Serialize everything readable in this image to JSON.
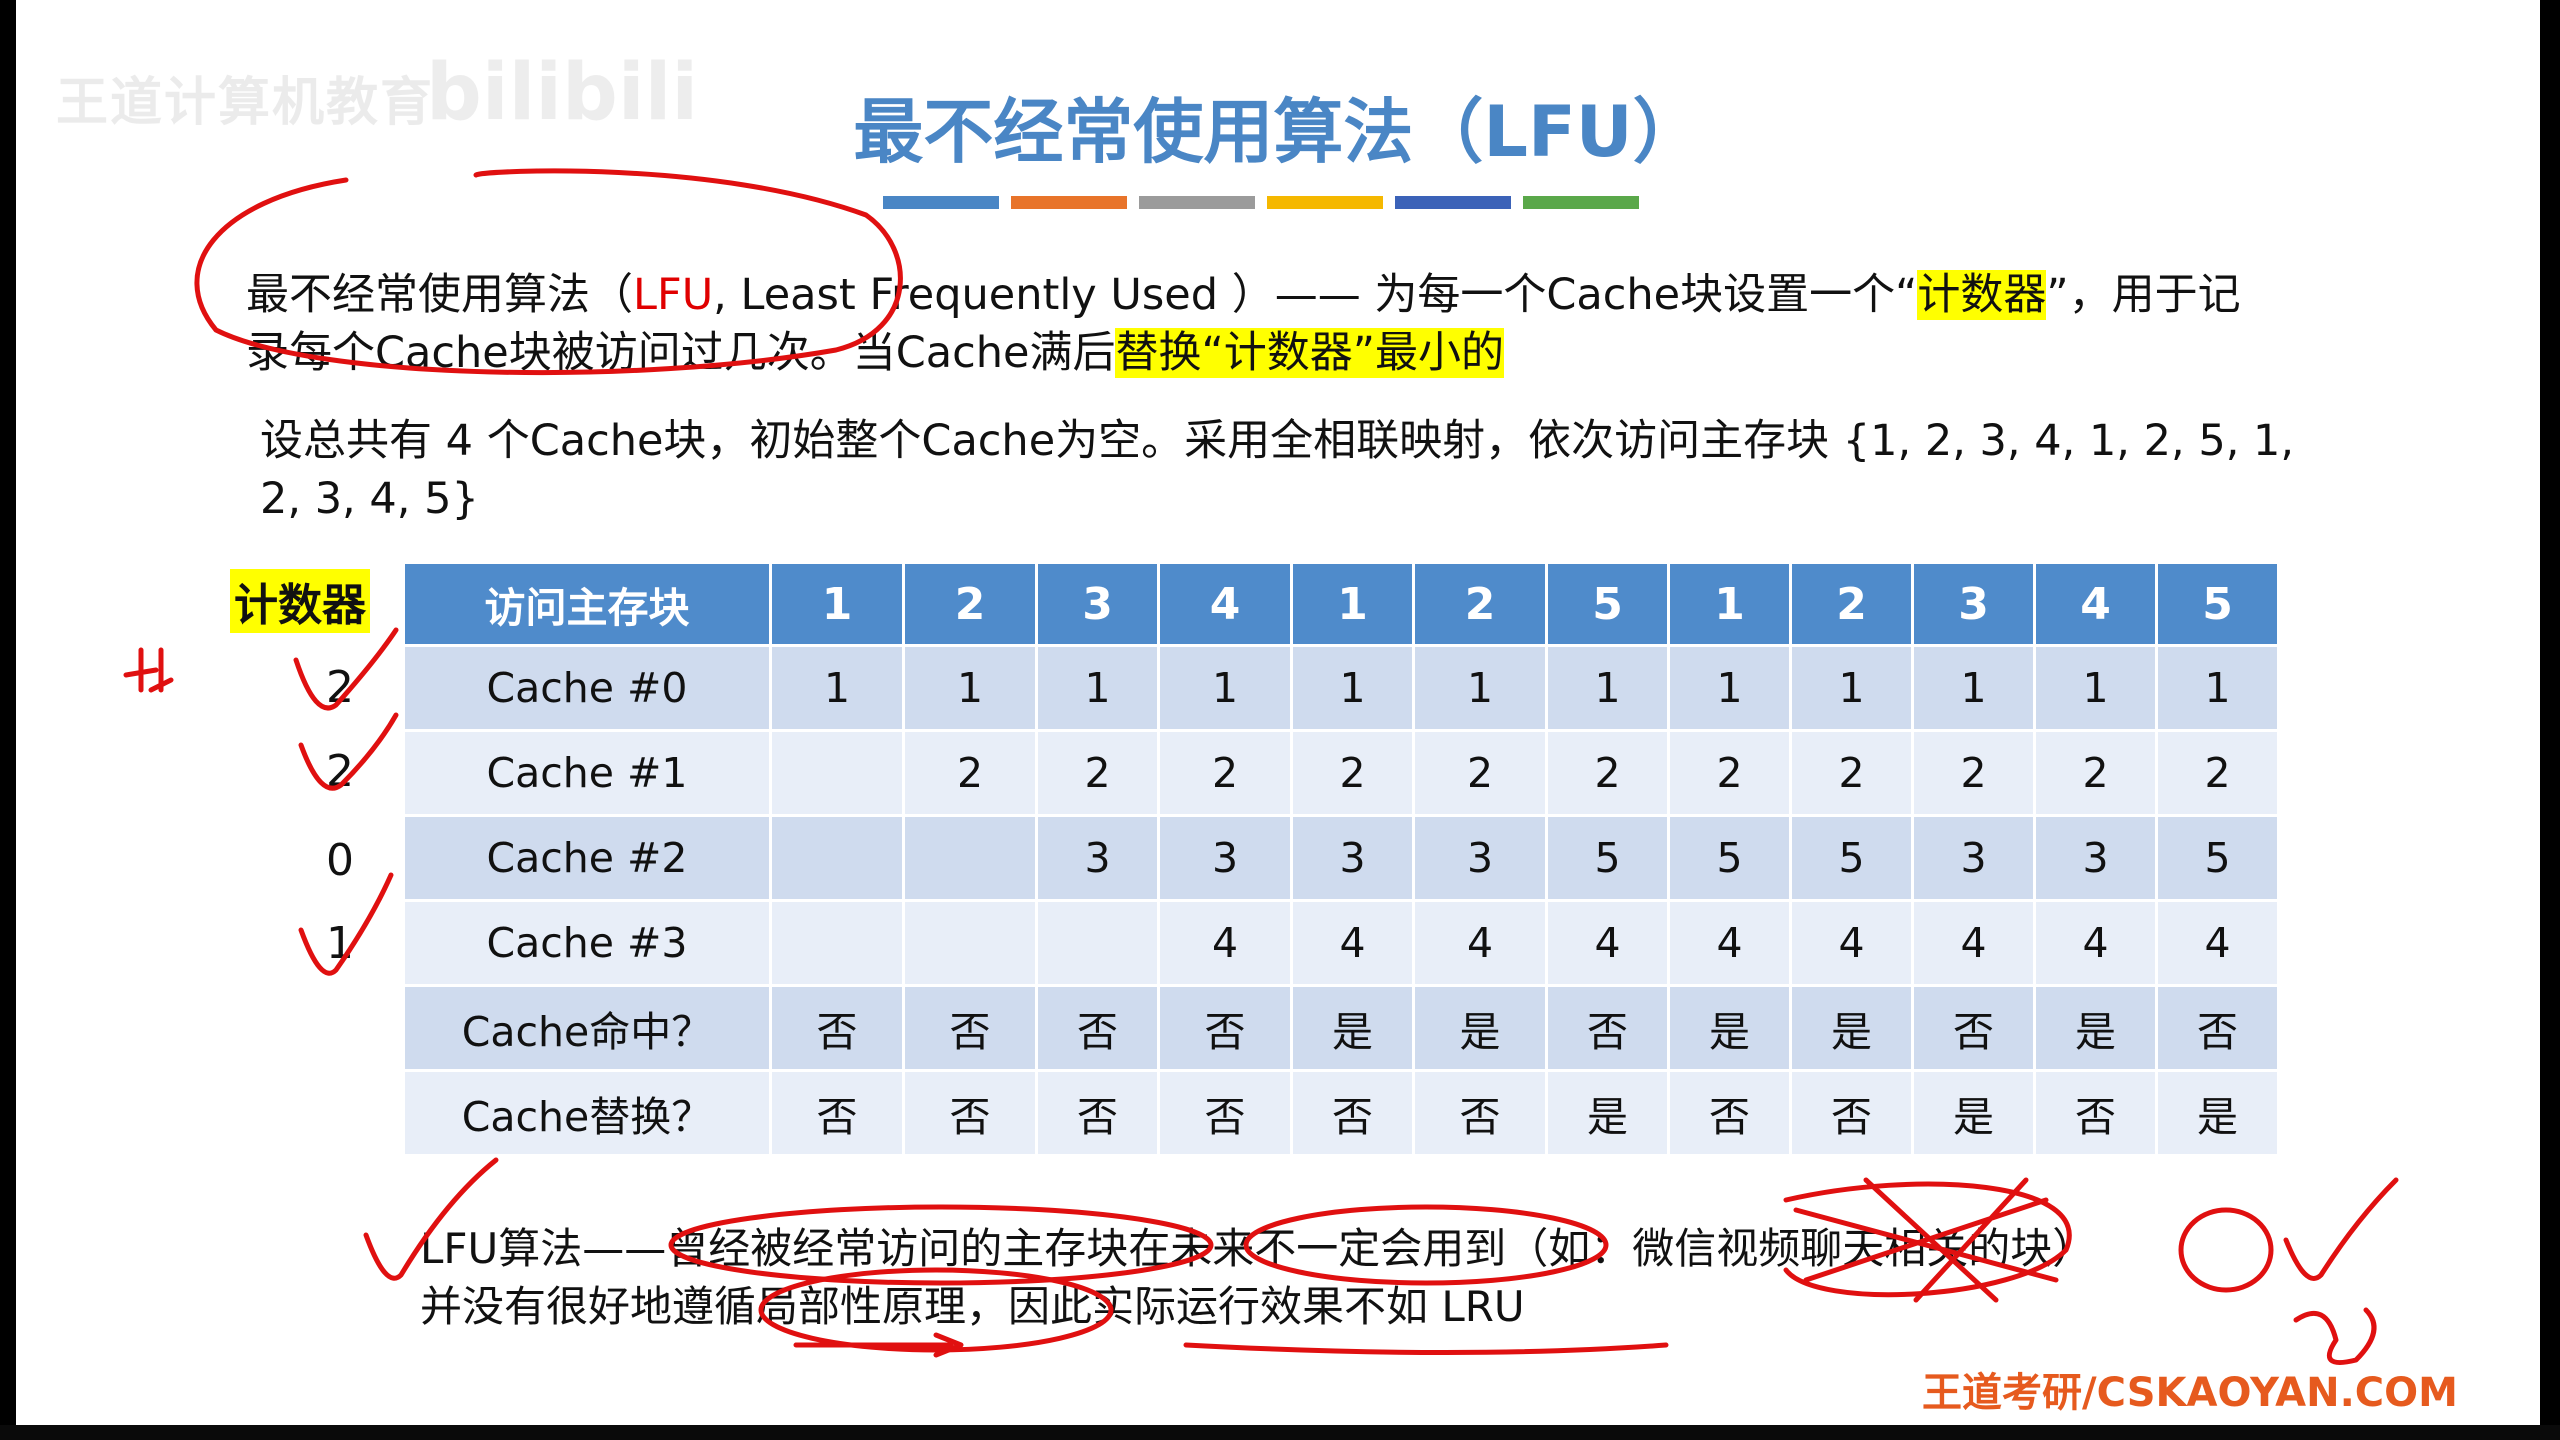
{
  "watermark": {
    "text": "王道计算机教育",
    "logo": "bilibili"
  },
  "title": "最不经常使用算法（LFU）",
  "title_bar_colors": [
    "#4a86c5",
    "#e8742a",
    "#9b9b9b",
    "#f5b800",
    "#3b62b8",
    "#5aa84a"
  ],
  "definition": {
    "part1": "最不经常使用算法（",
    "part2": "LFU",
    "part3": ", Least Frequently Used ）—— 为每一个Cache块设置一个“",
    "part4": "计数器",
    "part5": "”，用于记",
    "line2a": "录每个Cache块被访问过几次。当Cache满后",
    "line2b": "替换“计数器”最小的"
  },
  "setup": {
    "line1": "设总共有 4 个Cache块，初始整个Cache为空。采用全相联映射，依次访问主存块 {1, 2, 3, 4, 1, 2, 5, 1,",
    "line2": "2, 3, 4, 5}"
  },
  "counter": {
    "label": "计数器",
    "values": [
      "2",
      "2",
      "0",
      "1"
    ]
  },
  "table": {
    "header_label": "访问主存块",
    "accesses": [
      "1",
      "2",
      "3",
      "4",
      "1",
      "2",
      "5",
      "1",
      "2",
      "3",
      "4",
      "5"
    ],
    "rows": [
      {
        "label": "Cache #0",
        "cells": [
          [
            "1",
            "r"
          ],
          [
            "1",
            ""
          ],
          [
            "1",
            ""
          ],
          [
            "1",
            ""
          ],
          [
            "1",
            "g"
          ],
          [
            "1",
            ""
          ],
          [
            "1",
            ""
          ],
          [
            "1",
            "g"
          ],
          [
            "1",
            ""
          ],
          [
            "1",
            ""
          ],
          [
            "1",
            ""
          ],
          [
            "1",
            ""
          ]
        ]
      },
      {
        "label": "Cache #1",
        "cells": [
          [
            "",
            ""
          ],
          [
            "2",
            "r"
          ],
          [
            "2",
            ""
          ],
          [
            "2",
            ""
          ],
          [
            "2",
            ""
          ],
          [
            "2",
            "g"
          ],
          [
            "2",
            ""
          ],
          [
            "2",
            ""
          ],
          [
            "2",
            "g"
          ],
          [
            "2",
            ""
          ],
          [
            "2",
            ""
          ],
          [
            "2",
            ""
          ]
        ]
      },
      {
        "label": "Cache #2",
        "cells": [
          [
            "",
            ""
          ],
          [
            "",
            ""
          ],
          [
            "3",
            "r"
          ],
          [
            "3",
            ""
          ],
          [
            "3",
            ""
          ],
          [
            "3",
            ""
          ],
          [
            "5",
            "r"
          ],
          [
            "5",
            ""
          ],
          [
            "5",
            ""
          ],
          [
            "3",
            "r"
          ],
          [
            "3",
            ""
          ],
          [
            "5",
            "r"
          ]
        ]
      },
      {
        "label": "Cache #3",
        "cells": [
          [
            "",
            ""
          ],
          [
            "",
            ""
          ],
          [
            "",
            ""
          ],
          [
            "4",
            "r"
          ],
          [
            "4",
            ""
          ],
          [
            "4",
            ""
          ],
          [
            "4",
            ""
          ],
          [
            "4",
            ""
          ],
          [
            "4",
            ""
          ],
          [
            "4",
            ""
          ],
          [
            "4",
            "g"
          ],
          [
            "4",
            ""
          ]
        ]
      },
      {
        "label": "Cache命中？",
        "cells": [
          [
            "否",
            ""
          ],
          [
            "否",
            ""
          ],
          [
            "否",
            ""
          ],
          [
            "否",
            ""
          ],
          [
            "是",
            ""
          ],
          [
            "是",
            ""
          ],
          [
            "否",
            ""
          ],
          [
            "是",
            ""
          ],
          [
            "是",
            ""
          ],
          [
            "否",
            ""
          ],
          [
            "是",
            ""
          ],
          [
            "否",
            ""
          ]
        ]
      },
      {
        "label": "Cache替换？",
        "cells": [
          [
            "否",
            ""
          ],
          [
            "否",
            ""
          ],
          [
            "否",
            ""
          ],
          [
            "否",
            ""
          ],
          [
            "否",
            ""
          ],
          [
            "否",
            ""
          ],
          [
            "是",
            ""
          ],
          [
            "否",
            ""
          ],
          [
            "否",
            ""
          ],
          [
            "是",
            ""
          ],
          [
            "否",
            ""
          ],
          [
            "是",
            ""
          ]
        ]
      }
    ]
  },
  "conclusion": {
    "line1": "LFU算法——曾经被经常访问的主存块在未来不一定会用到（如：微信视频聊天相关的块）",
    "line2": "并没有很好地遵循局部性原理，因此实际运行效果不如 LRU"
  },
  "brand": "王道考研/CSKAOYAN.COM",
  "colors": {
    "red": "#e00000",
    "green": "#22a24a",
    "header_blue": "#4f8bcb",
    "highlight": "#ffff00"
  }
}
